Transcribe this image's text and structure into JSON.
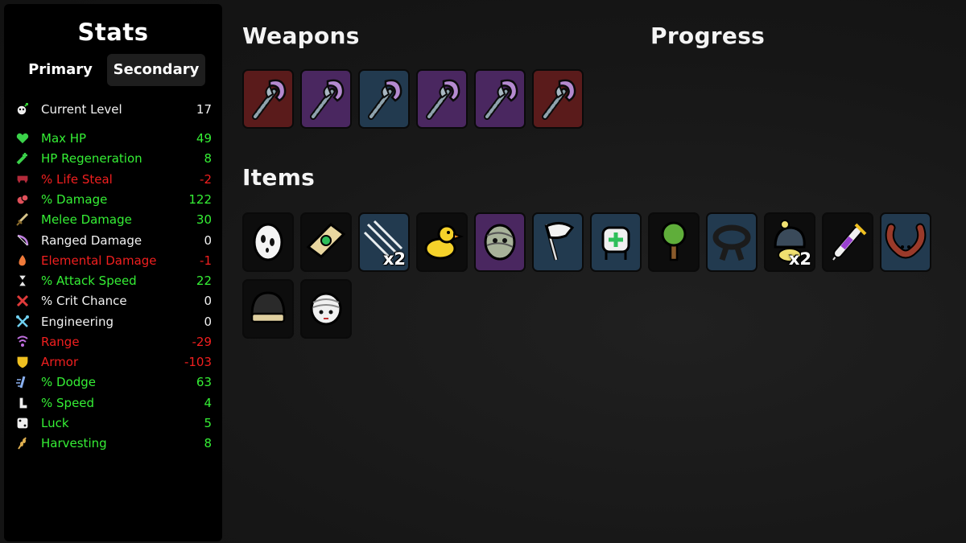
{
  "stats": {
    "title": "Stats",
    "tabs": {
      "primary": "Primary",
      "secondary": "Secondary"
    },
    "current_level": {
      "label": "Current Level",
      "value": "17"
    },
    "items": [
      {
        "label": "Max HP",
        "value": "49",
        "color": "green",
        "icon": "heart-icon"
      },
      {
        "label": "HP Regeneration",
        "value": "8",
        "color": "green",
        "icon": "regen-icon"
      },
      {
        "label": "% Life Steal",
        "value": "-2",
        "color": "red",
        "icon": "fangs-icon"
      },
      {
        "label": "% Damage",
        "value": "122",
        "color": "green",
        "icon": "muscle-icon"
      },
      {
        "label": "Melee Damage",
        "value": "30",
        "color": "green",
        "icon": "sword-icon"
      },
      {
        "label": "Ranged Damage",
        "value": "0",
        "color": "white",
        "icon": "bow-icon"
      },
      {
        "label": "Elemental Damage",
        "value": "-1",
        "color": "red",
        "icon": "flame-icon"
      },
      {
        "label": "% Attack Speed",
        "value": "22",
        "color": "green",
        "icon": "hourglass-icon"
      },
      {
        "label": "% Crit Chance",
        "value": "0",
        "color": "white",
        "icon": "crit-icon"
      },
      {
        "label": "Engineering",
        "value": "0",
        "color": "white",
        "icon": "wrench-icon"
      },
      {
        "label": "Range",
        "value": "-29",
        "color": "red",
        "icon": "range-icon"
      },
      {
        "label": "Armor",
        "value": "-103",
        "color": "red",
        "icon": "shield-icon"
      },
      {
        "label": "% Dodge",
        "value": "63",
        "color": "green",
        "icon": "dodge-icon"
      },
      {
        "label": "% Speed",
        "value": "4",
        "color": "green",
        "icon": "boot-icon"
      },
      {
        "label": "Luck",
        "value": "5",
        "color": "green",
        "icon": "dice-icon"
      },
      {
        "label": "Harvesting",
        "value": "8",
        "color": "green",
        "icon": "wheat-icon"
      }
    ]
  },
  "weapons": {
    "title": "Weapons",
    "slots": [
      {
        "tier": "red",
        "icon": "axe-icon"
      },
      {
        "tier": "purple",
        "icon": "axe-icon"
      },
      {
        "tier": "blue",
        "icon": "axe-icon"
      },
      {
        "tier": "purple",
        "icon": "axe-icon"
      },
      {
        "tier": "purple",
        "icon": "axe-icon"
      },
      {
        "tier": "red",
        "icon": "axe-icon"
      }
    ]
  },
  "progress": {
    "title": "Progress"
  },
  "items": {
    "title": "Items",
    "slots": [
      {
        "tier": "black",
        "icon": "egg-icon",
        "qty": ""
      },
      {
        "tier": "black",
        "icon": "cash-icon",
        "qty": ""
      },
      {
        "tier": "blue",
        "icon": "claw-scratch-icon",
        "qty": "x2"
      },
      {
        "tier": "black",
        "icon": "duck-icon",
        "qty": ""
      },
      {
        "tier": "purple",
        "icon": "mummy-icon",
        "qty": ""
      },
      {
        "tier": "blue",
        "icon": "white-flag-icon",
        "qty": ""
      },
      {
        "tier": "blue",
        "icon": "medkit-icon",
        "qty": ""
      },
      {
        "tier": "black",
        "icon": "tree-icon",
        "qty": ""
      },
      {
        "tier": "blue",
        "icon": "black-belt-icon",
        "qty": ""
      },
      {
        "tier": "black",
        "icon": "beanie-icon",
        "qty": "x2"
      },
      {
        "tier": "black",
        "icon": "syringe-icon",
        "qty": ""
      },
      {
        "tier": "blue",
        "icon": "tentacle-icon",
        "qty": ""
      },
      {
        "tier": "black",
        "icon": "helmet-icon",
        "qty": ""
      },
      {
        "tier": "black",
        "icon": "bandaged-head-icon",
        "qty": ""
      }
    ]
  },
  "colors": {
    "green": "#35ef35",
    "red": "#f11f1f",
    "white": "#f2f2f2",
    "tier_red": "#5a1b1b",
    "tier_purple": "#4a2760",
    "tier_blue": "#223a4f",
    "tier_black": "#0d0d0d"
  }
}
